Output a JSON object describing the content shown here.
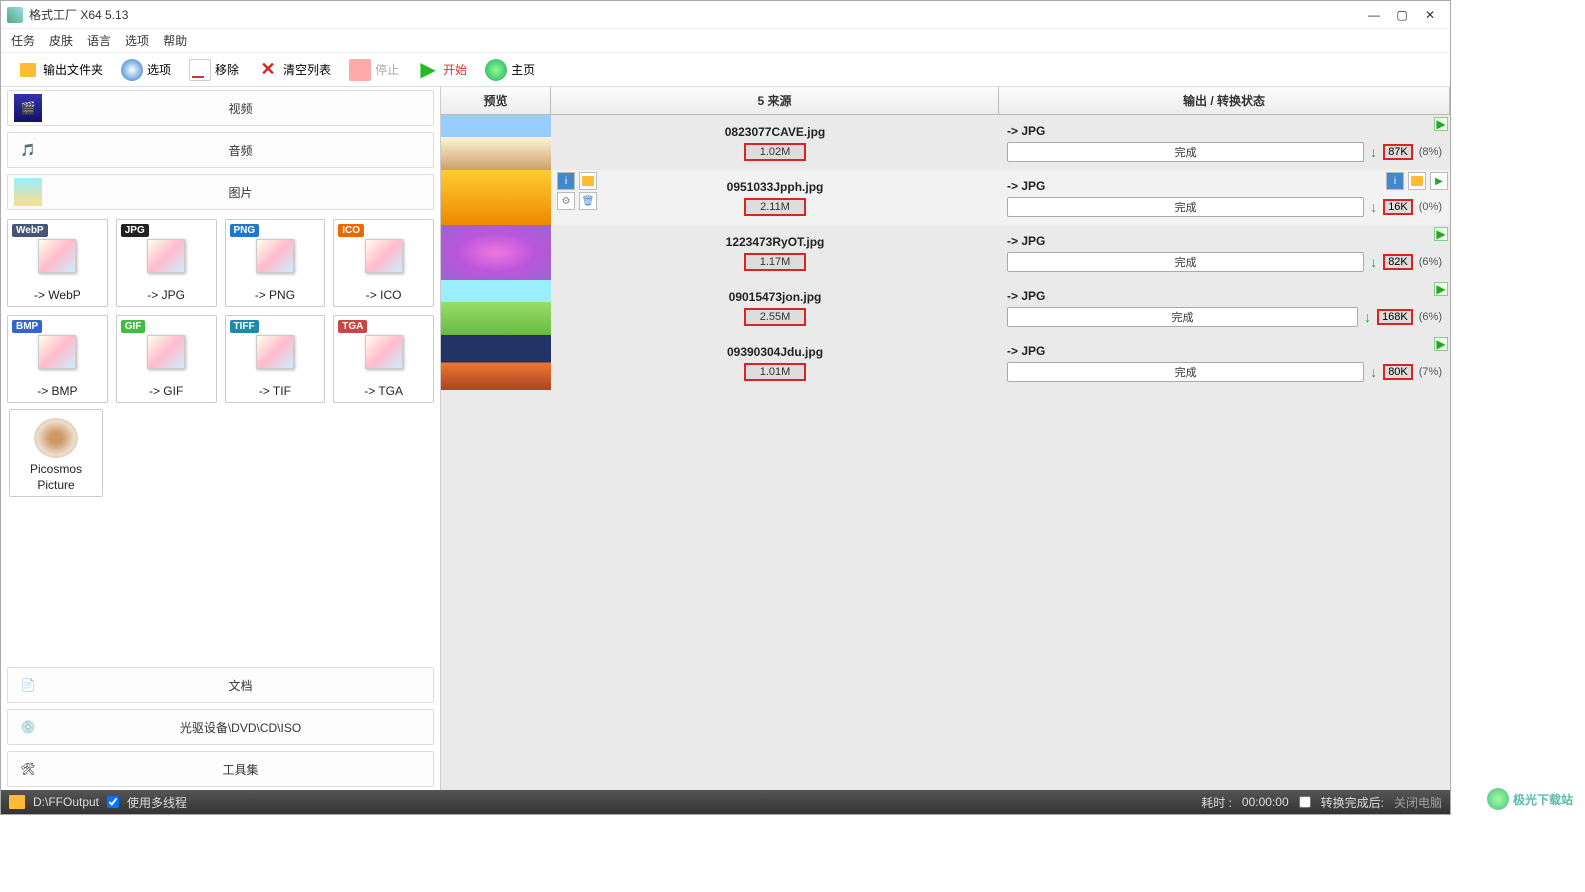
{
  "window": {
    "title": "格式工厂 X64 5.13"
  },
  "menu": {
    "task": "任务",
    "skin": "皮肤",
    "lang": "语言",
    "option": "选项",
    "help": "帮助"
  },
  "toolbar": {
    "output_folder": "输出文件夹",
    "options": "选项",
    "remove": "移除",
    "clear": "清空列表",
    "stop": "停止",
    "start": "开始",
    "home": "主页"
  },
  "categories": {
    "video": "视频",
    "audio": "音频",
    "image": "图片",
    "document": "文档",
    "disc": "光驱设备\\DVD\\CD\\ISO",
    "tools": "工具集"
  },
  "formats": [
    {
      "badge": "WebP",
      "color": "#457",
      "label": "-> WebP"
    },
    {
      "badge": "JPG",
      "color": "#222",
      "label": "-> JPG"
    },
    {
      "badge": "PNG",
      "color": "#27c",
      "label": "-> PNG"
    },
    {
      "badge": "ICO",
      "color": "#e60",
      "label": "-> ICO"
    },
    {
      "badge": "BMP",
      "color": "#36c",
      "label": "-> BMP"
    },
    {
      "badge": "GIF",
      "color": "#4b4",
      "label": "-> GIF"
    },
    {
      "badge": "TIFF",
      "color": "#28a",
      "label": "-> TIF"
    },
    {
      "badge": "TGA",
      "color": "#c44",
      "label": "-> TGA"
    }
  ],
  "picosmos": {
    "line1": "Picosmos",
    "line2": "Picture"
  },
  "list_header": {
    "preview": "预览",
    "source": "5 来源",
    "status": "输出 / 转换状态"
  },
  "rows": [
    {
      "file": "0823077CAVE.jpg",
      "size": "1.02M",
      "target": "-> JPG",
      "done": "完成",
      "ksize": "87K",
      "pct": "(8%)",
      "thumb": "linear-gradient(#9cf 40%,#fdf5d5 40%,#cda06a)"
    },
    {
      "file": "0951033Jpph.jpg",
      "size": "2.11M",
      "target": "-> JPG",
      "done": "完成",
      "ksize": "16K",
      "pct": "(0%)",
      "thumb": "linear-gradient(#fc3,#e80)",
      "selected": true
    },
    {
      "file": "1223473RyOT.jpg",
      "size": "1.17M",
      "target": "-> JPG",
      "done": "完成",
      "ksize": "82K",
      "pct": "(6%)",
      "thumb": "radial-gradient(#e7d,#b5d,#96c)"
    },
    {
      "file": "09015473jon.jpg",
      "size": "2.55M",
      "target": "-> JPG",
      "done": "完成",
      "ksize": "168K",
      "pct": "(6%)",
      "thumb": "linear-gradient(#9ef 40%,#9d6 40%,#6b4)"
    },
    {
      "file": "09390304Jdu.jpg",
      "size": "1.01M",
      "target": "-> JPG",
      "done": "完成",
      "ksize": "80K",
      "pct": "(7%)",
      "thumb": "linear-gradient(#236 50%,#e73 50%,#a42)"
    }
  ],
  "statusbar": {
    "path": "D:\\FFOutput",
    "multithread": "使用多线程",
    "elapsed_label": "耗时 :",
    "elapsed_time": "00:00:00",
    "after_label": "转换完成后:",
    "after_value": "关闭电脑"
  },
  "watermark": "极光下载站"
}
